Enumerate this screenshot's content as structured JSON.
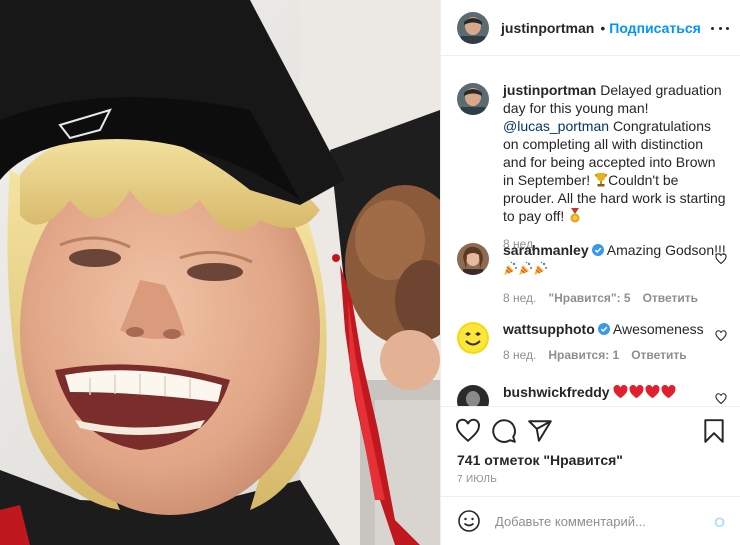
{
  "header": {
    "username": "justinportman",
    "separator": "•",
    "follow_label": "Подписаться"
  },
  "caption": {
    "username": "justinportman",
    "text_part1": "Delayed graduation day for this young man!",
    "mention": "@lucas_portman",
    "text_part2": "Congratulations on completing all with distinction and for being accepted into Brown in September!",
    "text_part3": "Couldn't be prouder. All the hard work is starting to pay off!",
    "time": "8 нед."
  },
  "comments": [
    {
      "username": "sarahmanley",
      "verified": true,
      "text": "Amazing Godson!!!",
      "time": "8 нед.",
      "likes": "\"Нравится\": 5",
      "reply": "Ответить"
    },
    {
      "username": "wattsupphoto",
      "verified": true,
      "text": "Awesomeness",
      "time": "8 нед.",
      "likes": "Нравится: 1",
      "reply": "Ответить"
    },
    {
      "username": "bushwickfreddy",
      "verified": false,
      "text": ""
    }
  ],
  "likes_text": "741 отметок \"Нравится\"",
  "date_text": "7 ИЮЛЬ",
  "add_comment": {
    "placeholder": "Добавьте комментарий...",
    "post_label": "О"
  },
  "icons": [
    "more-icon",
    "heart-icon",
    "comment-icon",
    "share-icon",
    "bookmark-icon",
    "emoji-icon",
    "verified-icon",
    "medal-icon",
    "party-horn-icon",
    "red-heart-icon"
  ],
  "colors": {
    "link": "#0095f6",
    "mention": "#00376b",
    "verified": "#3897f0",
    "muted": "#8e8e8e"
  }
}
